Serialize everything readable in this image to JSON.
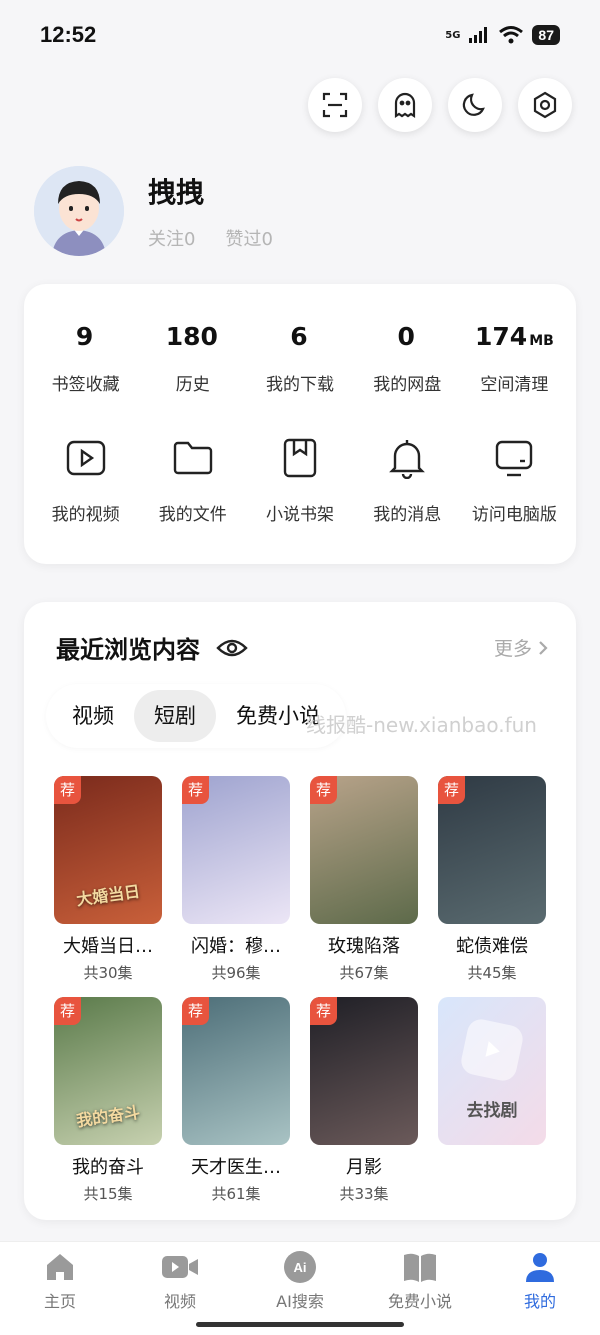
{
  "status": {
    "time": "12:52",
    "network": "5G",
    "battery": "87"
  },
  "profile": {
    "name": "拽拽",
    "follow": "关注0",
    "liked": "赞过0"
  },
  "stats": [
    {
      "value": "9",
      "unit": "",
      "label": "书签收藏"
    },
    {
      "value": "180",
      "unit": "",
      "label": "历史"
    },
    {
      "value": "6",
      "unit": "",
      "label": "我的下载"
    },
    {
      "value": "0",
      "unit": "",
      "label": "我的网盘"
    },
    {
      "value": "174",
      "unit": "MB",
      "label": "空间清理"
    }
  ],
  "tools": [
    {
      "label": "我的视频",
      "icon": "video-icon"
    },
    {
      "label": "我的文件",
      "icon": "folder-icon"
    },
    {
      "label": "小说书架",
      "icon": "bookmark-icon"
    },
    {
      "label": "我的消息",
      "icon": "bell-icon"
    },
    {
      "label": "访问电脑版",
      "icon": "monitor-icon"
    }
  ],
  "recent": {
    "title": "最近浏览内容",
    "more": "更多",
    "tabs": [
      "视频",
      "短剧",
      "免费小说"
    ],
    "active_tab": 1,
    "watermark": "线报酷-new.xianbao.fun",
    "badge": "荐",
    "items": [
      {
        "title": "大婚当日…",
        "episodes": "共30集",
        "poster_text": "大婚当日",
        "colors": [
          "#7a2a1c",
          "#c9603a"
        ]
      },
      {
        "title": "闪婚：穆…",
        "episodes": "共96集",
        "poster_text": "",
        "colors": [
          "#9ea3cf",
          "#ece6f6"
        ]
      },
      {
        "title": "玫瑰陷落",
        "episodes": "共67集",
        "poster_text": "",
        "colors": [
          "#b8a38a",
          "#5d6a4a"
        ]
      },
      {
        "title": "蛇债难偿",
        "episodes": "共45集",
        "poster_text": "",
        "colors": [
          "#2f3a44",
          "#5a6b70"
        ]
      },
      {
        "title": "我的奋斗",
        "episodes": "共15集",
        "poster_text": "我的奋斗",
        "colors": [
          "#5a7a4a",
          "#c7d1b0"
        ]
      },
      {
        "title": "天才医生…",
        "episodes": "共61集",
        "poster_text": "",
        "colors": [
          "#4d6e78",
          "#a9c3c4"
        ]
      },
      {
        "title": "月影",
        "episodes": "共33集",
        "poster_text": "",
        "colors": [
          "#1f1f26",
          "#6b5a5a"
        ]
      }
    ],
    "goto_label": "去找剧"
  },
  "nav": [
    {
      "label": "主页",
      "icon": "home-icon"
    },
    {
      "label": "视频",
      "icon": "video-camera-icon"
    },
    {
      "label": "AI搜索",
      "icon": "ai-icon"
    },
    {
      "label": "免费小说",
      "icon": "book-icon"
    },
    {
      "label": "我的",
      "icon": "user-icon"
    }
  ],
  "colors": {
    "accent": "#2f6bde",
    "badge": "#e8543e"
  }
}
